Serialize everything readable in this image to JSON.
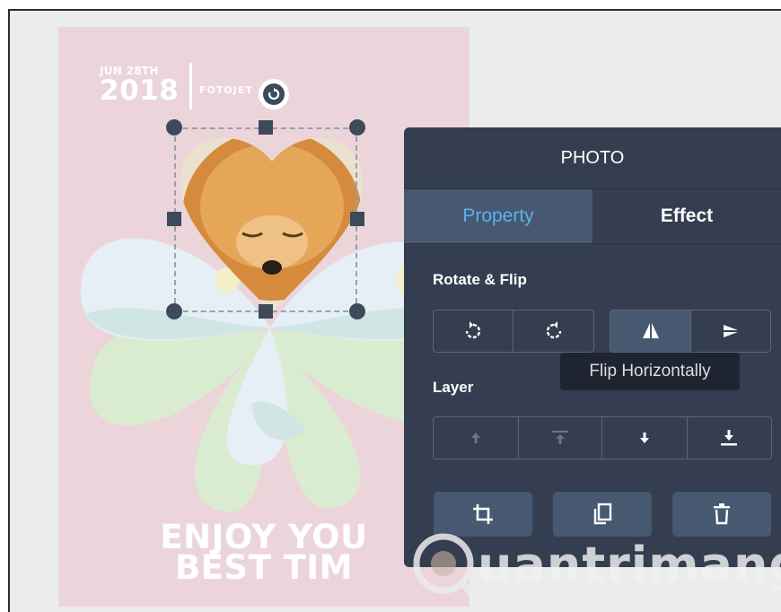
{
  "poster": {
    "date_month": "JUN 28TH",
    "date_year": "2018",
    "brand": "FOTOJET",
    "headline_line1": "ENJOY YOU",
    "headline_line2": "BEST TIM",
    "background_color": "#ecd5da"
  },
  "panel": {
    "title": "PHOTO",
    "tabs": [
      {
        "label": "Property",
        "active": true
      },
      {
        "label": "Effect",
        "active": false
      }
    ],
    "rotate_flip_label": "Rotate & Flip",
    "layer_label": "Layer",
    "tooltip": "Flip Horizontally",
    "rotate_buttons": [
      "rotate-left-icon",
      "rotate-right-icon"
    ],
    "flip_buttons": [
      "flip-horizontal-icon",
      "flip-vertical-icon"
    ],
    "layer_buttons": [
      "bring-forward-icon",
      "bring-to-front-icon",
      "send-backward-icon",
      "send-to-back-icon"
    ],
    "action_buttons": [
      "crop-icon",
      "duplicate-icon",
      "delete-icon"
    ]
  },
  "watermark": {
    "text": "uantrimang"
  },
  "colors": {
    "panel_bg": "#353e50",
    "panel_button": "#475871",
    "accent": "#5ab2ea",
    "handle": "#3d4a5c"
  }
}
